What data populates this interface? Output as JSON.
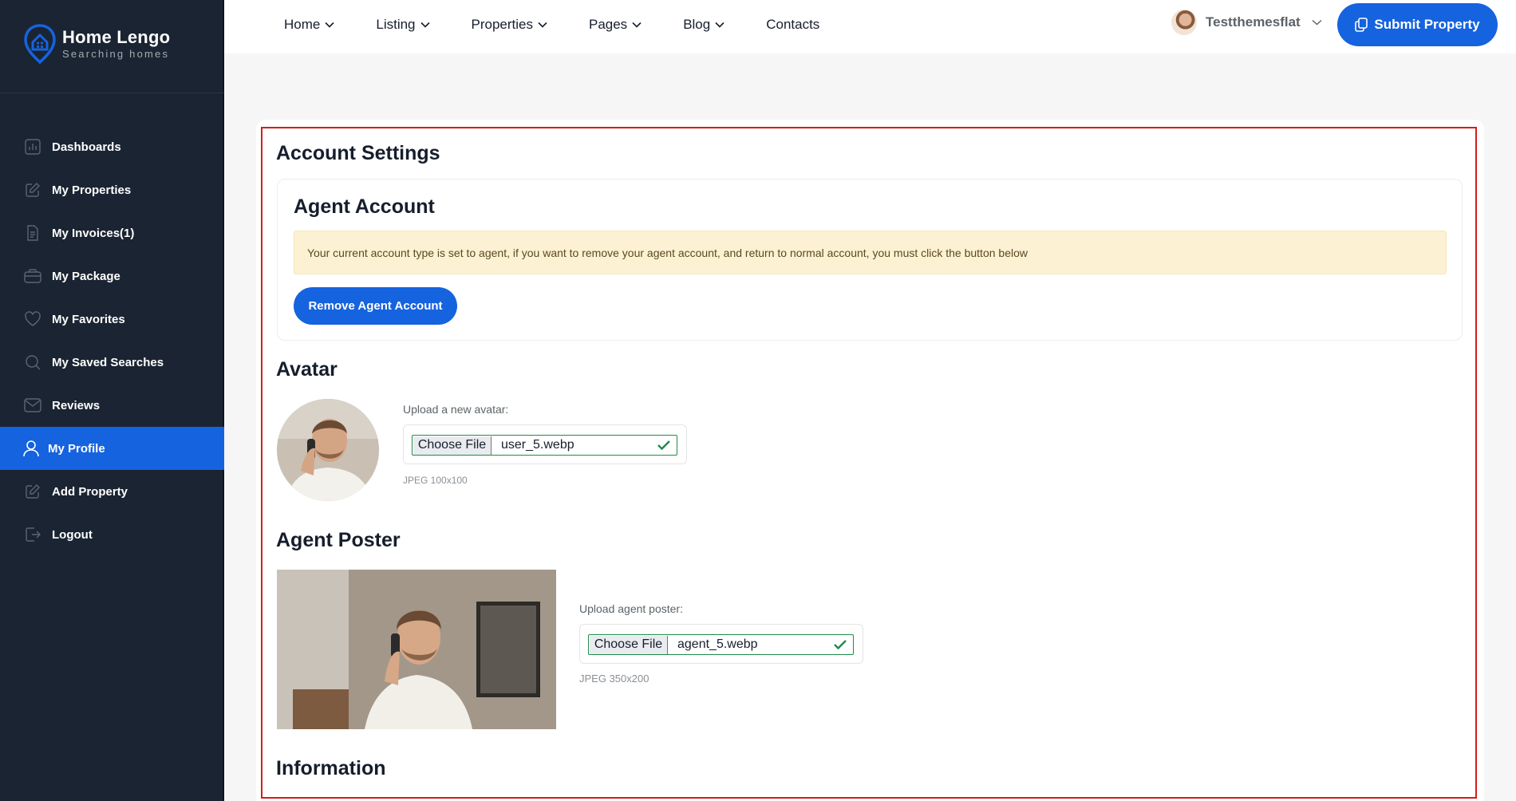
{
  "brand": {
    "title": "Home Lengo",
    "subtitle": "Searching homes",
    "color": "#1563df"
  },
  "sidebar": {
    "items": [
      {
        "label": "Dashboards",
        "icon": "chart-icon"
      },
      {
        "label": "My Properties",
        "icon": "edit-icon"
      },
      {
        "label": "My Invoices(1)",
        "icon": "document-icon"
      },
      {
        "label": "My Package",
        "icon": "package-icon"
      },
      {
        "label": "My Favorites",
        "icon": "heart-icon"
      },
      {
        "label": "My Saved Searches",
        "icon": "search-icon"
      },
      {
        "label": "Reviews",
        "icon": "mail-icon"
      },
      {
        "label": "My Profile",
        "icon": "user-icon",
        "active": true
      },
      {
        "label": "Add Property",
        "icon": "edit-icon"
      },
      {
        "label": "Logout",
        "icon": "logout-icon"
      }
    ]
  },
  "header": {
    "nav": [
      "Home",
      "Listing",
      "Properties",
      "Pages",
      "Blog",
      "Contacts"
    ],
    "username": "Testthemesflat",
    "submit_label": "Submit Property"
  },
  "main": {
    "title": "Account Settings",
    "agent_card": {
      "title": "Agent Account",
      "alert": "Your current account type is set to agent, if you want to remove your agent account, and return to normal account, you must click the button below",
      "remove_label": "Remove Agent Account"
    },
    "avatar": {
      "title": "Avatar",
      "upload_label": "Upload a new avatar:",
      "choose_label": "Choose File",
      "file_name": "user_5.webp",
      "hint": "JPEG 100x100"
    },
    "poster": {
      "title": "Agent Poster",
      "upload_label": "Upload agent poster:",
      "choose_label": "Choose File",
      "file_name": "agent_5.webp",
      "hint": "JPEG 350x200"
    },
    "information_title": "Information"
  }
}
